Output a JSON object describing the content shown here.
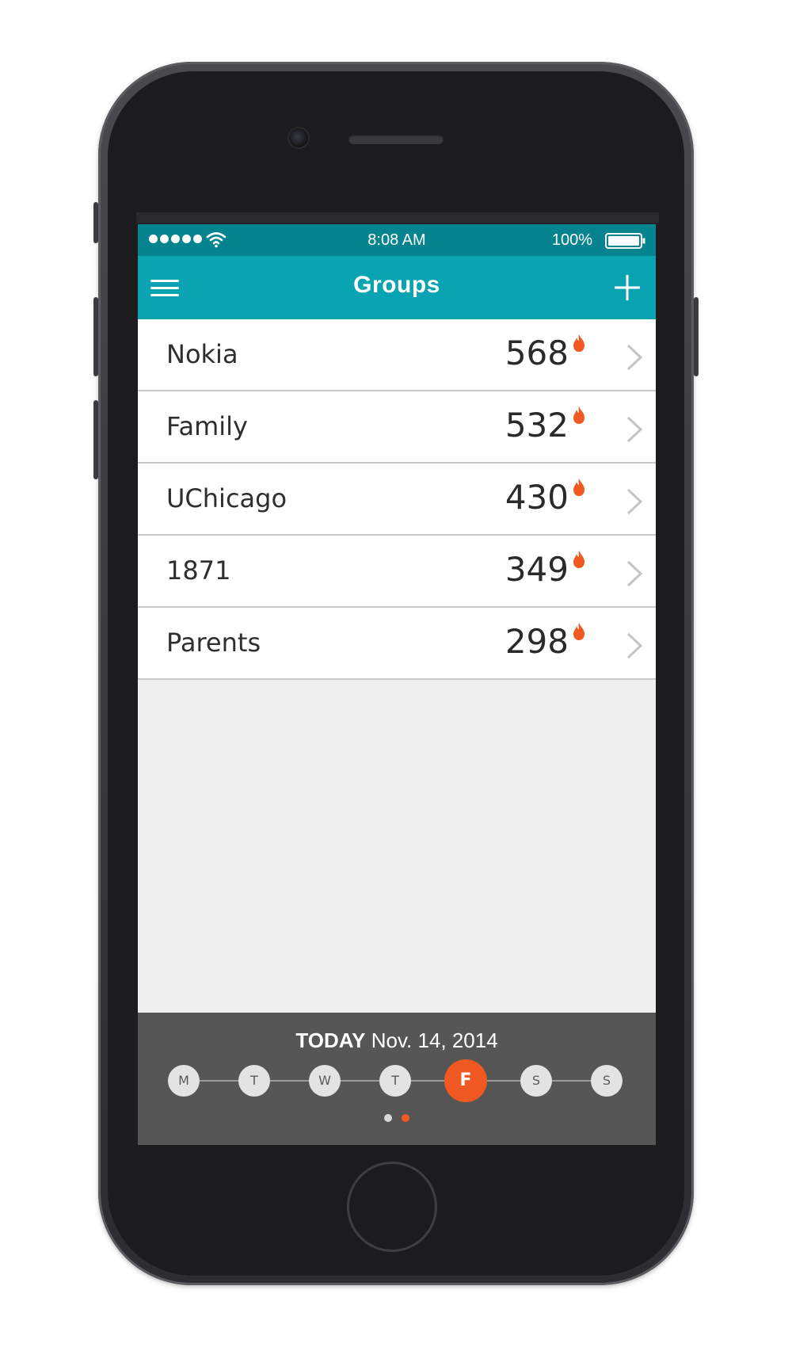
{
  "status_bar": {
    "time": "8:08 AM",
    "battery_percent": "100%",
    "signal_bars": 5
  },
  "nav": {
    "title": "Groups",
    "menu_icon": "hamburger-menu-icon",
    "add_icon": "plus-icon"
  },
  "groups": [
    {
      "name": "Nokia",
      "score": "568"
    },
    {
      "name": "Family",
      "score": "532"
    },
    {
      "name": "UChicago",
      "score": "430"
    },
    {
      "name": "1871",
      "score": "349"
    },
    {
      "name": "Parents",
      "score": "298"
    }
  ],
  "footer": {
    "date_label": "TODAY",
    "date": "Nov. 14, 2014",
    "days": [
      "M",
      "T",
      "W",
      "T",
      "F",
      "S",
      "S"
    ],
    "selected_day_index": 4,
    "pages": 2,
    "active_page_index": 1
  },
  "colors": {
    "status_bar": "#05848f",
    "nav_bar": "#0aa3b2",
    "accent": "#f05a22",
    "footer": "#565656",
    "list_background": "#efefef"
  }
}
